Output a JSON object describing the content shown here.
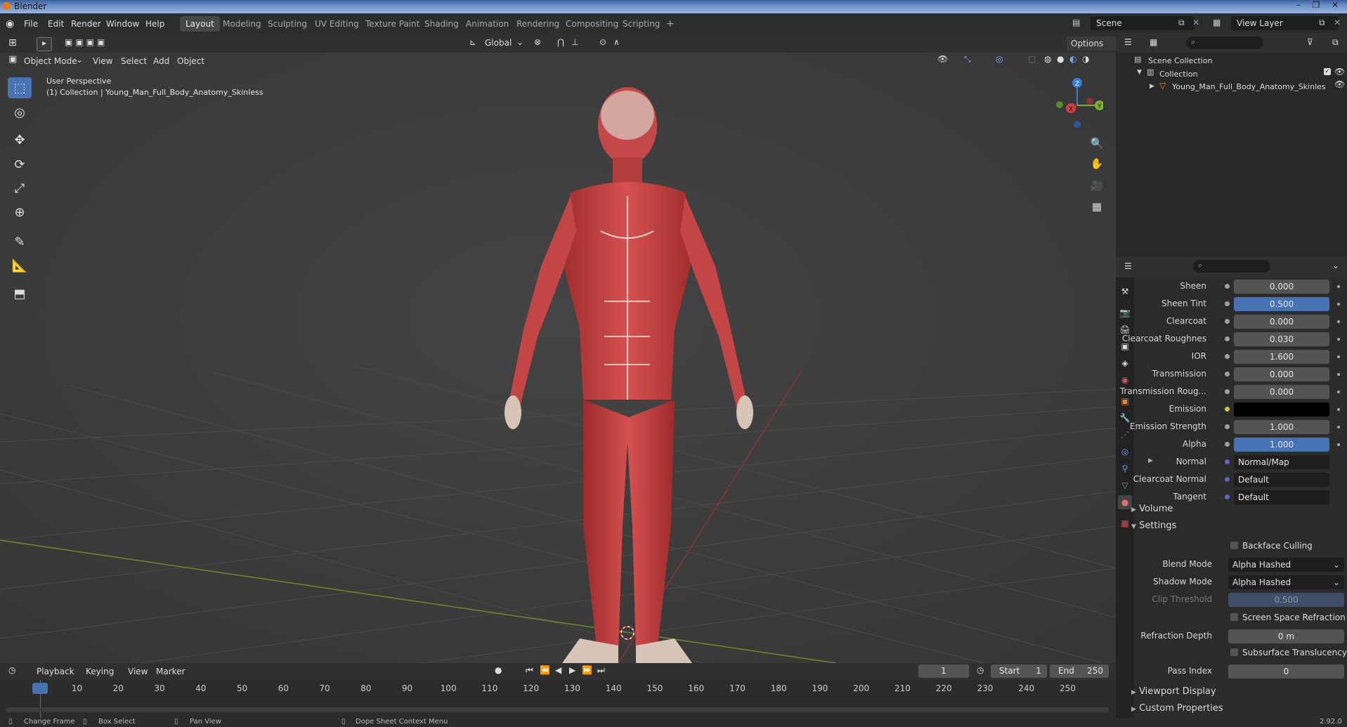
{
  "window": {
    "title": "Blender"
  },
  "menus": [
    "File",
    "Edit",
    "Render",
    "Window",
    "Help"
  ],
  "workspaces": [
    "Layout",
    "Modeling",
    "Sculpting",
    "UV Editing",
    "Texture Paint",
    "Shading",
    "Animation",
    "Rendering",
    "Compositing",
    "Scripting"
  ],
  "workspace_add": "+",
  "scene": {
    "value": "Scene"
  },
  "view_layer": {
    "value": "View Layer"
  },
  "viewport_header": {
    "orientation": "Global",
    "options": "Options",
    "mode": "Object Mode",
    "menus": [
      "View",
      "Select",
      "Add",
      "Object"
    ]
  },
  "viewport": {
    "perspective": "User Perspective",
    "collection_info": "(1) Collection | Young_Man_Full_Body_Anatomy_Skinless",
    "gizmo_axes": {
      "z": "Z",
      "y": "Y",
      "x": "X"
    }
  },
  "outliner": {
    "scene_collection": "Scene Collection",
    "collection": "Collection",
    "object": "Young_Man_Full_Body_Anatomy_Skinles"
  },
  "properties": {
    "rows": [
      {
        "label": "Sheen",
        "value": "0.000",
        "style": "gray"
      },
      {
        "label": "Sheen Tint",
        "value": "0.500",
        "style": "blue"
      },
      {
        "label": "Clearcoat",
        "value": "0.000",
        "style": "gray"
      },
      {
        "label": "Clearcoat Roughnes",
        "value": "0.030",
        "style": "gray"
      },
      {
        "label": "IOR",
        "value": "1.600",
        "style": "gray"
      },
      {
        "label": "Transmission",
        "value": "0.000",
        "style": "gray"
      },
      {
        "label": "Transmission Roug...",
        "value": "0.000",
        "style": "gray"
      },
      {
        "label": "Emission",
        "value": "",
        "style": "black"
      },
      {
        "label": "Emission Strength",
        "value": "1.000",
        "style": "gray"
      },
      {
        "label": "Alpha",
        "value": "1.000",
        "style": "blue"
      }
    ],
    "links": [
      {
        "label": "Normal",
        "value": "Normal/Map"
      },
      {
        "label": "Clearcoat Normal",
        "value": "Default"
      },
      {
        "label": "Tangent",
        "value": "Default"
      }
    ],
    "volume": "Volume",
    "settings": "Settings",
    "backface_culling": "Backface Culling",
    "blend_mode": {
      "label": "Blend Mode",
      "value": "Alpha Hashed"
    },
    "shadow_mode": {
      "label": "Shadow Mode",
      "value": "Alpha Hashed"
    },
    "clip_threshold": {
      "label": "Clip Threshold",
      "value": "0.500"
    },
    "screen_space_refraction": "Screen Space Refraction",
    "refraction_depth": {
      "label": "Refraction Depth",
      "value": "0 m"
    },
    "subsurface_translucency": "Subsurface Translucency",
    "pass_index": {
      "label": "Pass Index",
      "value": "0"
    },
    "viewport_display": "Viewport Display",
    "custom_properties": "Custom Properties"
  },
  "timeline": {
    "menus": [
      "Playback",
      "Keying",
      "View",
      "Marker"
    ],
    "current_frame": "1",
    "start_label": "Start",
    "start": "1",
    "end_label": "End",
    "end": "250",
    "ticks": [
      "1",
      "10",
      "20",
      "30",
      "40",
      "50",
      "60",
      "70",
      "80",
      "90",
      "100",
      "110",
      "120",
      "130",
      "140",
      "150",
      "160",
      "170",
      "180",
      "190",
      "200",
      "210",
      "220",
      "230",
      "240",
      "250"
    ]
  },
  "statusbar": {
    "items": [
      "Change Frame",
      "Box Select",
      "Pan View",
      "Dope Sheet Context Menu"
    ],
    "version": "2.92.0"
  },
  "colors": {
    "accent": "#4772b3",
    "header": "#303030",
    "viewport": "#3d3d3d",
    "brand": "#e87d0d"
  }
}
